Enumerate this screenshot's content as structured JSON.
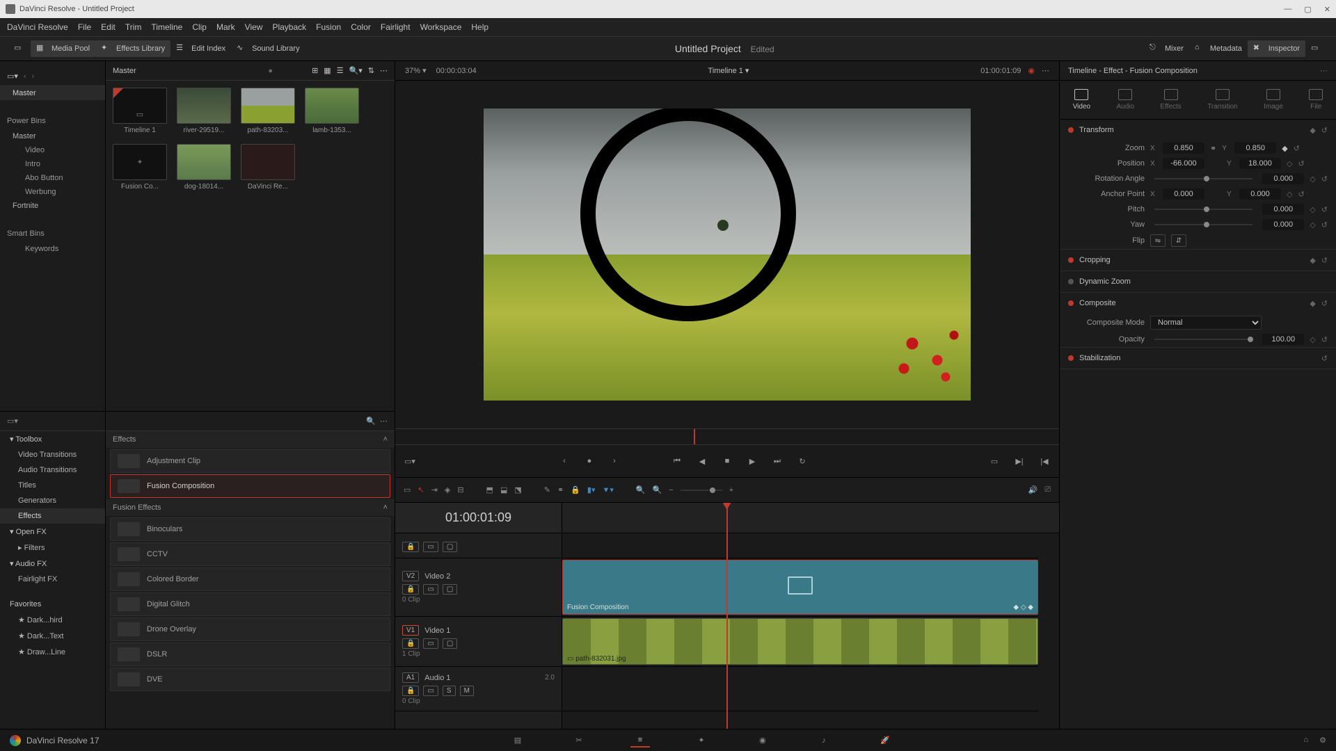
{
  "window": {
    "title": "DaVinci Resolve - Untitled Project"
  },
  "menu": [
    "DaVinci Resolve",
    "File",
    "Edit",
    "Trim",
    "Timeline",
    "Clip",
    "Mark",
    "View",
    "Playback",
    "Fusion",
    "Color",
    "Fairlight",
    "Workspace",
    "Help"
  ],
  "toolbar": {
    "media_pool": "Media Pool",
    "effects_library": "Effects Library",
    "edit_index": "Edit Index",
    "sound_library": "Sound Library",
    "mixer": "Mixer",
    "metadata": "Metadata",
    "inspector": "Inspector"
  },
  "project": {
    "title": "Untitled Project",
    "status": "Edited"
  },
  "viewer": {
    "zoom": "37%",
    "src_tc": "00:00:03:04",
    "timeline_name": "Timeline 1",
    "rec_tc": "01:00:01:09"
  },
  "bins": {
    "master": "Master",
    "power": "Power Bins",
    "power_items": [
      "Master",
      "Video",
      "Intro",
      "Abo Button",
      "Werbung",
      "Fortnite"
    ],
    "smart": "Smart Bins",
    "smart_items": [
      "Keywords"
    ]
  },
  "thumbs": [
    {
      "label": "Timeline 1"
    },
    {
      "label": "river-29519..."
    },
    {
      "label": "path-83203..."
    },
    {
      "label": "lamb-1353..."
    },
    {
      "label": "Fusion Co..."
    },
    {
      "label": "dog-18014..."
    },
    {
      "label": "DaVinci Re..."
    }
  ],
  "fxnav": {
    "toolbox": "Toolbox",
    "toolbox_items": [
      "Video Transitions",
      "Audio Transitions",
      "Titles",
      "Generators",
      "Effects"
    ],
    "openfx": "Open FX",
    "openfx_items": [
      "Filters"
    ],
    "audiofx": "Audio FX",
    "audiofx_items": [
      "Fairlight FX"
    ],
    "favorites": "Favorites",
    "fav_items": [
      "Dark...hird",
      "Dark...Text",
      "Draw...Line"
    ]
  },
  "fxlist": {
    "cat1": "Effects",
    "effects": [
      "Adjustment Clip",
      "Fusion Composition"
    ],
    "cat2": "Fusion Effects",
    "fusion": [
      "Binoculars",
      "CCTV",
      "Colored Border",
      "Digital Glitch",
      "Drone Overlay",
      "DSLR",
      "DVE"
    ]
  },
  "timeline": {
    "tc": "01:00:01:09",
    "tracks": {
      "v2": {
        "id": "V2",
        "name": "Video 2",
        "clips": "0 Clip"
      },
      "v1": {
        "id": "V1",
        "name": "Video 1",
        "clips": "1 Clip"
      },
      "a1": {
        "id": "A1",
        "name": "Audio 1",
        "ch": "2.0",
        "clips": "0 Clip"
      }
    },
    "fusion_clip": "Fusion Composition",
    "video_clip": "path-832031.jpg"
  },
  "inspector": {
    "title": "Timeline - Effect - Fusion Composition",
    "tabs": [
      "Video",
      "Audio",
      "Effects",
      "Transition",
      "Image",
      "File"
    ],
    "transform": {
      "label": "Transform",
      "zoom": {
        "label": "Zoom",
        "x": "0.850",
        "y": "0.850"
      },
      "position": {
        "label": "Position",
        "x": "-66.000",
        "y": "18.000"
      },
      "rotation": {
        "label": "Rotation Angle",
        "v": "0.000"
      },
      "anchor": {
        "label": "Anchor Point",
        "x": "0.000",
        "y": "0.000"
      },
      "pitch": {
        "label": "Pitch",
        "v": "0.000"
      },
      "yaw": {
        "label": "Yaw",
        "v": "0.000"
      },
      "flip": {
        "label": "Flip"
      }
    },
    "cropping": "Cropping",
    "dynzoom": "Dynamic Zoom",
    "composite": {
      "label": "Composite",
      "mode_lbl": "Composite Mode",
      "mode": "Normal",
      "opacity_lbl": "Opacity",
      "opacity": "100.00"
    },
    "stab": "Stabilization"
  },
  "footer": {
    "app": "DaVinci Resolve 17"
  }
}
